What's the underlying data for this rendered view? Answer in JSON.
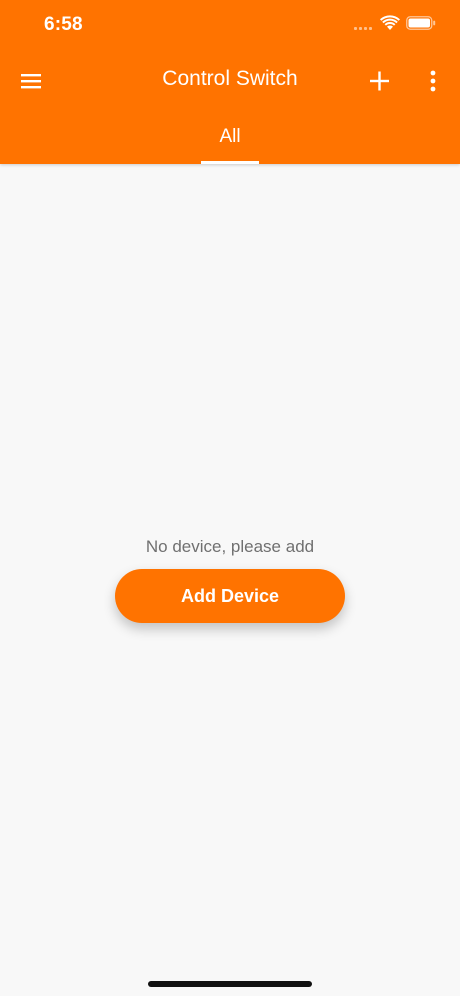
{
  "status_bar": {
    "time": "6:58",
    "icons": [
      "signal-icon",
      "wifi-icon",
      "battery-icon"
    ]
  },
  "toolbar": {
    "title": "Control Switch",
    "icons": [
      "menu-icon",
      "add-icon",
      "more-icon"
    ]
  },
  "tabs": [
    {
      "label": "All",
      "selected": true
    }
  ],
  "empty_state": {
    "message": "No device, please add",
    "button_label": "Add Device"
  },
  "colors": {
    "accent": "#FF7300",
    "background": "#F8F8F8",
    "text_muted": "#707070"
  }
}
